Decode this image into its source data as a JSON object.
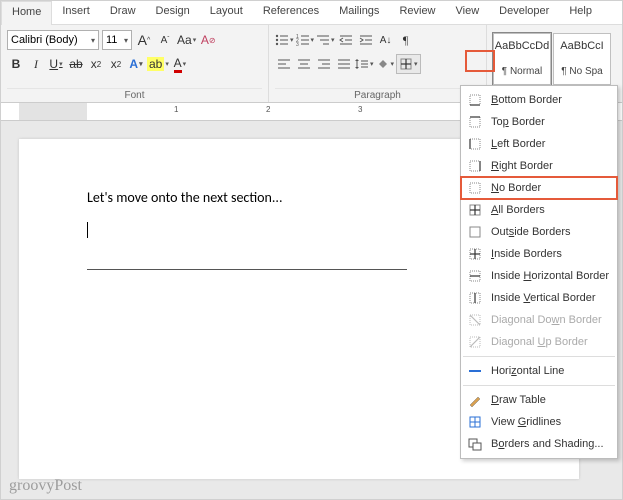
{
  "tabs": [
    "Home",
    "Insert",
    "Draw",
    "Design",
    "Layout",
    "References",
    "Mailings",
    "Review",
    "View",
    "Developer",
    "Help"
  ],
  "active_tab": 0,
  "font": {
    "name": "Calibri (Body)",
    "size": "11",
    "bold": "B",
    "italic": "I",
    "underline": "U",
    "strike": "ab",
    "sub": "x",
    "sup": "x",
    "grow": "A",
    "shrink": "A",
    "case": "Aa",
    "clear": "A",
    "color": "A",
    "highlight": "ab",
    "effects": "A"
  },
  "groups": {
    "font": "Font",
    "paragraph": "Paragraph"
  },
  "styles": [
    {
      "preview": "AaBbCcDd",
      "name": "¶ Normal"
    },
    {
      "preview": "AaBbCcI",
      "name": "¶ No Spa"
    }
  ],
  "document": {
    "text": "Let's move onto the next section..."
  },
  "border_menu": {
    "items": [
      {
        "key": "bottom",
        "label_pre": "",
        "label_u": "B",
        "label_post": "ottom Border"
      },
      {
        "key": "top",
        "label_pre": "To",
        "label_u": "p",
        "label_post": " Border"
      },
      {
        "key": "left",
        "label_pre": "",
        "label_u": "L",
        "label_post": "eft Border"
      },
      {
        "key": "right",
        "label_pre": "",
        "label_u": "R",
        "label_post": "ight Border"
      },
      {
        "key": "none",
        "label_pre": "",
        "label_u": "N",
        "label_post": "o Border",
        "highlight": true
      },
      {
        "key": "all",
        "label_pre": "",
        "label_u": "A",
        "label_post": "ll Borders"
      },
      {
        "key": "outside",
        "label_pre": "Out",
        "label_u": "s",
        "label_post": "ide Borders"
      },
      {
        "key": "inside",
        "label_pre": "",
        "label_u": "I",
        "label_post": "nside Borders"
      },
      {
        "key": "ih",
        "label_pre": "Inside ",
        "label_u": "H",
        "label_post": "orizontal Border"
      },
      {
        "key": "iv",
        "label_pre": "Inside ",
        "label_u": "V",
        "label_post": "ertical Border"
      },
      {
        "key": "dd",
        "label_pre": "Diagonal Do",
        "label_u": "w",
        "label_post": "n Border",
        "disabled": true
      },
      {
        "key": "du",
        "label_pre": "Diagonal ",
        "label_u": "U",
        "label_post": "p Border",
        "disabled": true
      },
      {
        "sep": true
      },
      {
        "key": "hline",
        "label_pre": "Hori",
        "label_u": "z",
        "label_post": "ontal Line",
        "icon": "hline"
      },
      {
        "sep": true
      },
      {
        "key": "draw",
        "label_pre": "",
        "label_u": "D",
        "label_post": "raw Table",
        "icon": "draw"
      },
      {
        "key": "grid",
        "label_pre": "View ",
        "label_u": "G",
        "label_post": "ridlines",
        "icon": "grid"
      },
      {
        "key": "dialog",
        "label_pre": "B",
        "label_u": "o",
        "label_post": "rders and Shading...",
        "icon": "dialog"
      }
    ]
  },
  "watermark": "groovyPost",
  "ruler_numbers": [
    "1",
    "2",
    "3"
  ]
}
